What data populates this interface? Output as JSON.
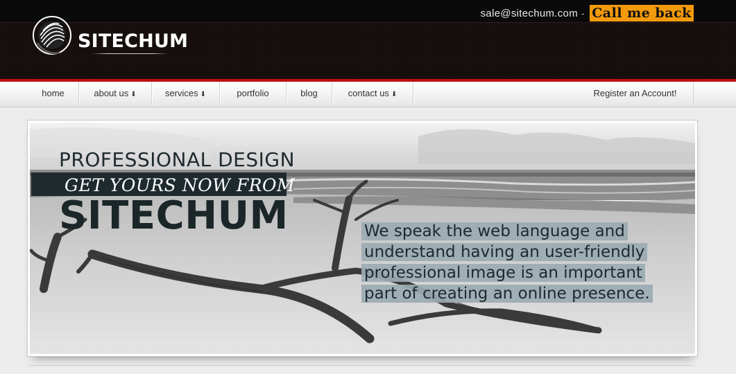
{
  "header": {
    "email": "sale@sitechum.com",
    "separator": "-",
    "callback_label": "Call me back",
    "logo_text": "SITECHUM",
    "colors": {
      "callback_bg": "#f39a0b",
      "accent_red": "#c00f0f"
    }
  },
  "nav": {
    "items": [
      {
        "label": "home",
        "dropdown": false
      },
      {
        "label": "about us",
        "dropdown": true
      },
      {
        "label": "services",
        "dropdown": true
      },
      {
        "label": "portfolio",
        "dropdown": false
      },
      {
        "label": "blog",
        "dropdown": false
      },
      {
        "label": "contact us",
        "dropdown": true
      }
    ],
    "dropdown_glyph": "⬇",
    "register_label": "Register an Account!"
  },
  "banner": {
    "line1": "PROFESSIONAL DESIGN",
    "line2": "GET YOURS NOW FROM",
    "line3": "SITECHUM",
    "tagline_lines": [
      "We speak the web language and",
      "understand having an user-friendly",
      "professional image is an important",
      "part of creating an online presence."
    ]
  }
}
